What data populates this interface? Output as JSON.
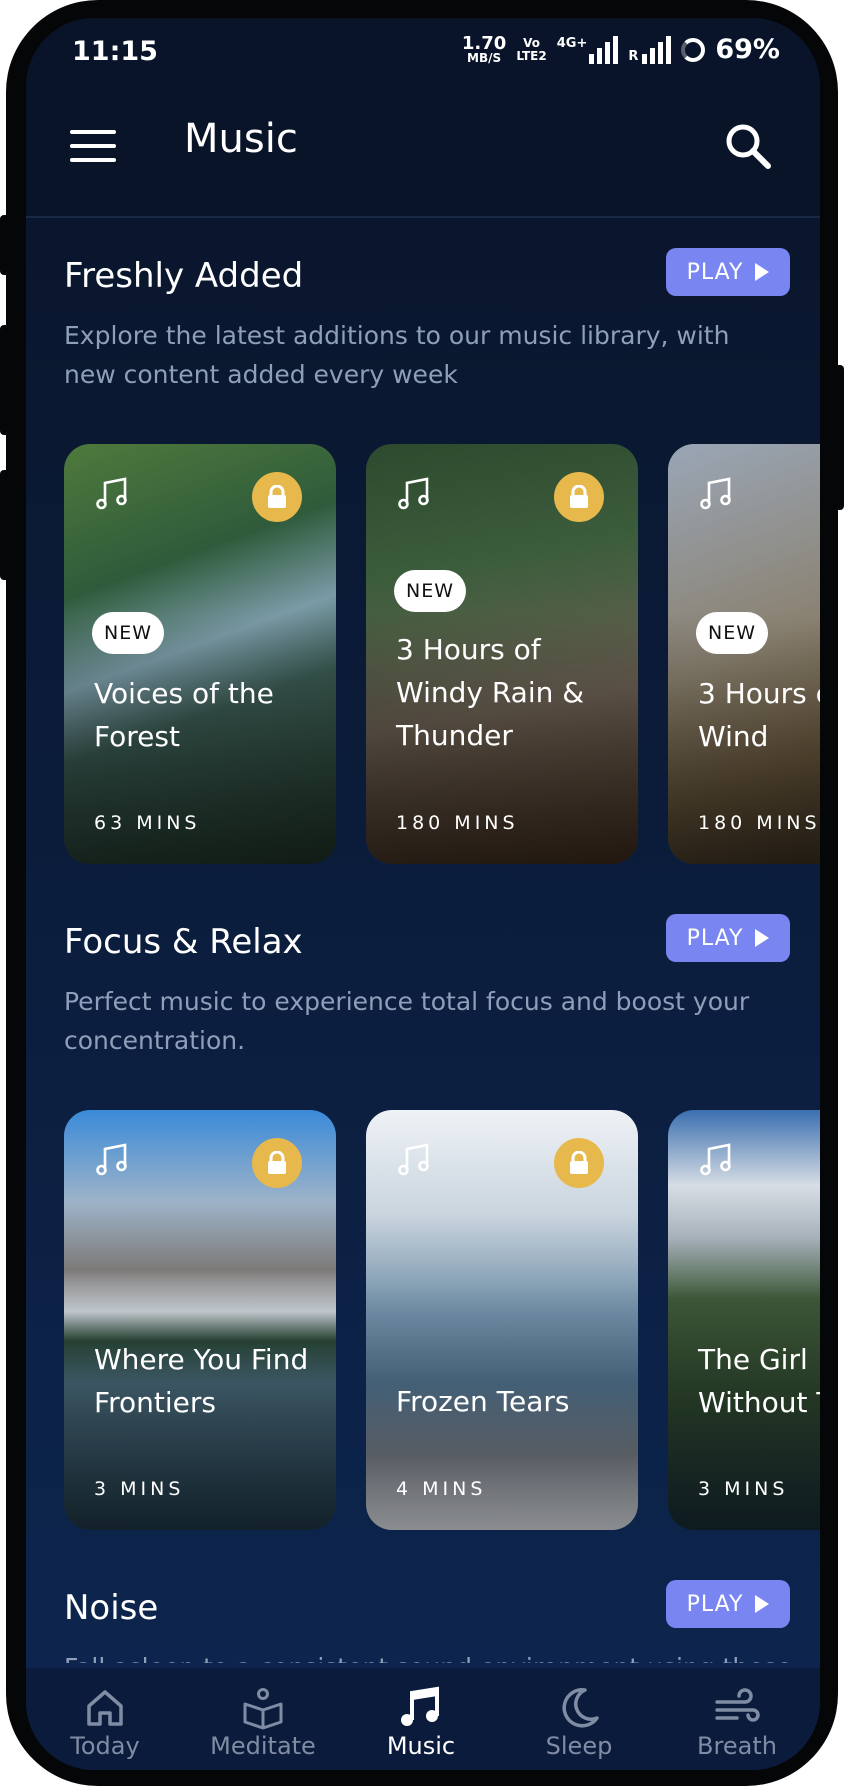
{
  "status_bar": {
    "time": "11:15",
    "net_speed_value": "1.70",
    "net_speed_unit": "MB/S",
    "volte_top": "Vo",
    "volte_bottom": "LTE2",
    "network_type": "4G+",
    "roaming": "R",
    "battery": "69%"
  },
  "app_bar": {
    "title": "Music",
    "menu_icon": "hamburger-menu-icon",
    "search_icon": "search-icon"
  },
  "sections": [
    {
      "title": "Freshly Added",
      "play_label": "PLAY",
      "description": "Explore the latest additions to our music library, with new content added every week",
      "cards": [
        {
          "title": "Voices of the Forest",
          "duration": "63 MINS",
          "badge": "NEW",
          "locked": true
        },
        {
          "title": "3 Hours of Windy Rain & Thunder",
          "duration": "180 MINS",
          "badge": "NEW",
          "locked": true
        },
        {
          "title": "3 Hours c Wind",
          "duration": "180 MINS",
          "badge": "NEW",
          "locked": false
        }
      ]
    },
    {
      "title": "Focus & Relax",
      "play_label": "PLAY",
      "description": "Perfect music to experience total focus and boost your concentration.",
      "cards": [
        {
          "title": "Where You Find Frontiers",
          "duration": "3 MINS",
          "locked": true
        },
        {
          "title": "Frozen Tears",
          "duration": "4 MINS",
          "locked": true
        },
        {
          "title": "The Girl Without T",
          "duration": "3 MINS",
          "locked": false
        }
      ]
    },
    {
      "title": "Noise",
      "play_label": "PLAY",
      "description": "Fall asleep to a consistent sound environment using these"
    }
  ],
  "bottom_nav": {
    "items": [
      {
        "label": "Today",
        "icon": "home-icon",
        "active": false
      },
      {
        "label": "Meditate",
        "icon": "book-meditate-icon",
        "active": false
      },
      {
        "label": "Music",
        "icon": "music-note-icon",
        "active": true
      },
      {
        "label": "Sleep",
        "icon": "moon-icon",
        "active": false
      },
      {
        "label": "Breath",
        "icon": "wind-icon",
        "active": false
      }
    ]
  },
  "colors": {
    "accent": "#7985f0",
    "lock_badge": "#e7b84c",
    "background": "#0b1c3a",
    "muted_text": "#8f9fb9"
  }
}
